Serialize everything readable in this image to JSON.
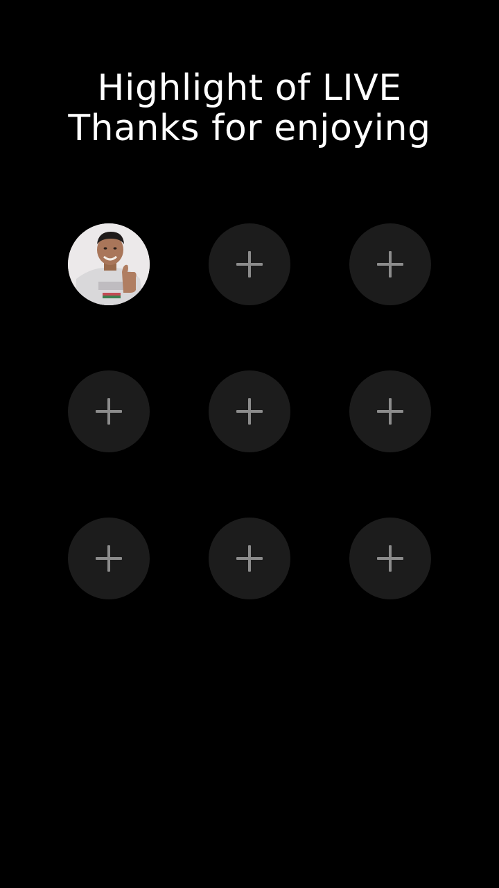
{
  "header": {
    "line1": "Highlight of LIVE",
    "line2": "Thanks for enjoying"
  },
  "grid": {
    "slots": [
      {
        "type": "avatar",
        "icon": "user-avatar"
      },
      {
        "type": "add",
        "icon": "plus-icon"
      },
      {
        "type": "add",
        "icon": "plus-icon"
      },
      {
        "type": "add",
        "icon": "plus-icon"
      },
      {
        "type": "add",
        "icon": "plus-icon"
      },
      {
        "type": "add",
        "icon": "plus-icon"
      },
      {
        "type": "add",
        "icon": "plus-icon"
      },
      {
        "type": "add",
        "icon": "plus-icon"
      },
      {
        "type": "add",
        "icon": "plus-icon"
      }
    ]
  },
  "colors": {
    "background": "#000000",
    "slot": "#1c1c1c",
    "plus": "#8c8c8c",
    "text": "#ffffff"
  }
}
